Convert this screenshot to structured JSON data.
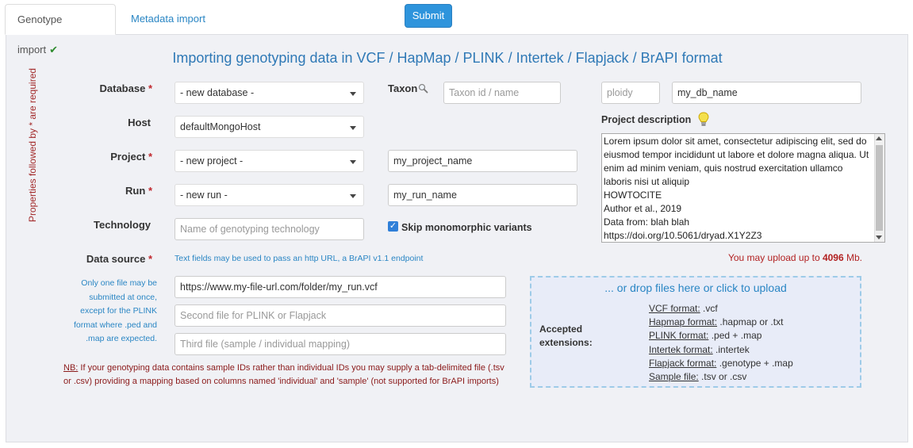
{
  "tabs": {
    "genotype_import": "Genotype import",
    "metadata_import": "Metadata import"
  },
  "submit_label": "Submit",
  "title": "Importing genotyping data in VCF / HapMap / PLINK / Intertek / Flapjack / BrAPI format",
  "required_note": "Properties followed by * are required",
  "labels": {
    "database": "Database",
    "host": "Host",
    "project": "Project",
    "run": "Run",
    "technology": "Technology",
    "data_source": "Data source",
    "taxon": "Taxon",
    "project_description": "Project description",
    "required_mark": "*"
  },
  "fields": {
    "database_select": "- new database -",
    "host_select": "defaultMongoHost",
    "project_select": "- new project -",
    "run_select": "- new run -",
    "technology_placeholder": "Name of genotyping technology",
    "taxon_placeholder": "Taxon id / name",
    "ploidy_placeholder": "ploidy",
    "db_name_value": "my_db_name",
    "project_name_value": "my_project_name",
    "run_name_value": "my_run_name",
    "file1_value": "https://www.my-file-url.com/folder/my_run.vcf",
    "file2_placeholder": "Second file for PLINK or Flapjack",
    "file3_placeholder": "Third file (sample / individual mapping)"
  },
  "skip_monomorphic": {
    "label": "Skip monomorphic variants",
    "checked": true
  },
  "project_description_text": "Lorem ipsum dolor sit amet, consectetur adipiscing elit, sed do eiusmod tempor incididunt ut labore et dolore magna aliqua. Ut enim ad minim veniam, quis nostrud exercitation ullamco laboris nisi ut aliquip\nHOWTOCITE\nAuthor et al., 2019\nData from: blah blah\nhttps://doi.org/10.5061/dryad.X1Y2Z3",
  "data_source_hint": {
    "prefix": "Text fields may be used to pass an http URL, a ",
    "link": "BrAPI v1.1 endpoint"
  },
  "file_note": "Only one file may be submitted at once, except for the PLINK format where .ped and .map are expected.",
  "nb": {
    "label": "NB:",
    "text": " If your genotyping data contains sample IDs rather than individual IDs you may supply a tab-delimited file (.tsv or .csv) providing a mapping based on columns named 'individual' and 'sample' (not supported for BrAPI imports)"
  },
  "upload_limit": {
    "prefix": "You may upload up to ",
    "value": "4096",
    "suffix": " Mb."
  },
  "dropzone": {
    "title": "... or drop files here or click to upload",
    "accepted_label": "Accepted extensions:",
    "formats": [
      {
        "name": "VCF format:",
        "ext": ".vcf"
      },
      {
        "name": "Hapmap format:",
        "ext": ".hapmap or .txt"
      },
      {
        "name": "PLINK format:",
        "ext": ".ped + .map"
      },
      {
        "name": "Intertek format:",
        "ext": ".intertek"
      },
      {
        "name": "Flapjack format:",
        "ext": ".genotype + .map"
      },
      {
        "name": "Sample file:",
        "ext": ".tsv or .csv"
      }
    ]
  },
  "colors": {
    "accent": "#2e94dc",
    "title": "#2f79b6",
    "required": "#c0272d",
    "panel_bg": "#f0f1f5",
    "dropzone_bg": "#e8ecf8"
  }
}
